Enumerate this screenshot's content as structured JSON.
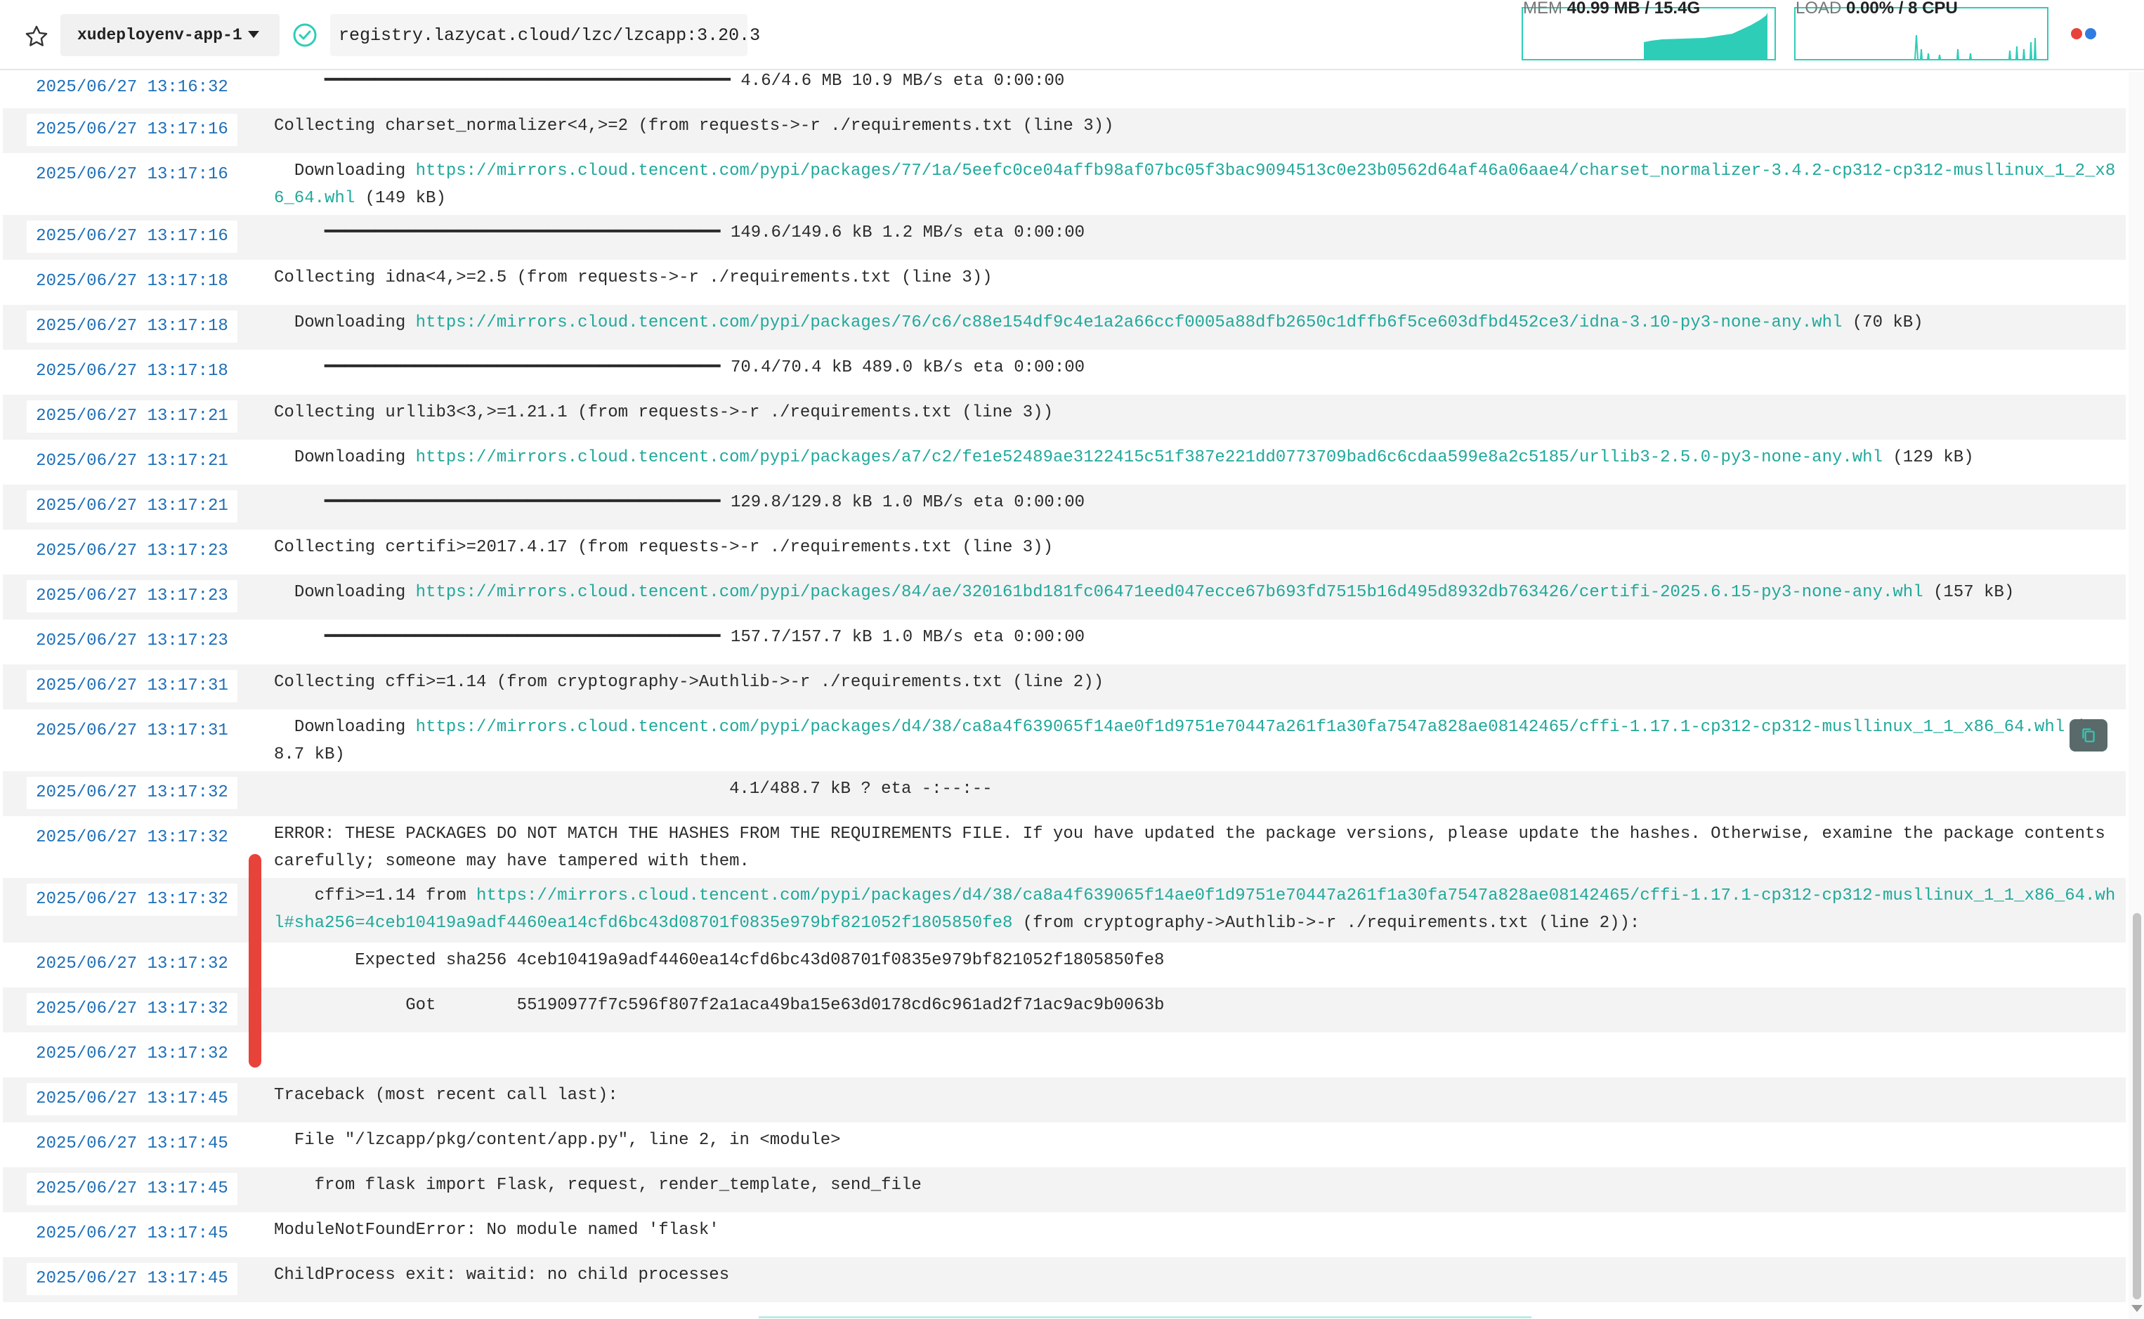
{
  "header": {
    "app_name": "xudeployenv-app-1",
    "image": "registry.lazycat.cloud/lzc/lzcapp:3.20.3",
    "mem": {
      "label": "MEM",
      "value": "40.99 MB / 15.4G"
    },
    "load": {
      "label": "LOAD",
      "value": "0.00% / 8 CPU"
    },
    "accent": "#2ecdb8",
    "status_dots": [
      "#e8433a",
      "#2f7de1"
    ]
  },
  "log": [
    {
      "ts": "2025/06/27 13:16:32",
      "parts": [
        {
          "t": "     ━━━━━━━━━━━━━━━━━━━━━━━━━━━━━━━━━━━━━━━━ 4.6/4.6 MB 10.9 MB/s eta 0:00:00"
        }
      ]
    },
    {
      "ts": "2025/06/27 13:17:16",
      "parts": [
        {
          "t": "Collecting charset_normalizer<4,>=2 (from requests->-r ./requirements.txt (line 3))"
        }
      ]
    },
    {
      "ts": "2025/06/27 13:17:16",
      "parts": [
        {
          "t": "  Downloading "
        },
        {
          "t": "https://mirrors.cloud.tencent.com/pypi/packages/77/1a/5eefc0ce04affb98af07bc05f3bac9094513c0e23b0562d64af46a06aae4/charset_normalizer-3.4.2-cp312-cp312-musllinux_1_2_x86_64.whl",
          "link": true
        },
        {
          "t": " (149 kB)"
        }
      ]
    },
    {
      "ts": "2025/06/27 13:17:16",
      "parts": [
        {
          "t": "     ━━━━━━━━━━━━━━━━━━━━━━━━━━━━━━━━━━━━━━━ 149.6/149.6 kB 1.2 MB/s eta 0:00:00"
        }
      ]
    },
    {
      "ts": "2025/06/27 13:17:18",
      "parts": [
        {
          "t": "Collecting idna<4,>=2.5 (from requests->-r ./requirements.txt (line 3))"
        }
      ]
    },
    {
      "ts": "2025/06/27 13:17:18",
      "parts": [
        {
          "t": "  Downloading "
        },
        {
          "t": "https://mirrors.cloud.tencent.com/pypi/packages/76/c6/c88e154df9c4e1a2a66ccf0005a88dfb2650c1dffb6f5ce603dfbd452ce3/idna-3.10-py3-none-any.whl",
          "link": true
        },
        {
          "t": " (70 kB)"
        }
      ]
    },
    {
      "ts": "2025/06/27 13:17:18",
      "parts": [
        {
          "t": "     ━━━━━━━━━━━━━━━━━━━━━━━━━━━━━━━━━━━━━━━ 70.4/70.4 kB 489.0 kB/s eta 0:00:00"
        }
      ]
    },
    {
      "ts": "2025/06/27 13:17:21",
      "parts": [
        {
          "t": "Collecting urllib3<3,>=1.21.1 (from requests->-r ./requirements.txt (line 3))"
        }
      ]
    },
    {
      "ts": "2025/06/27 13:17:21",
      "parts": [
        {
          "t": "  Downloading "
        },
        {
          "t": "https://mirrors.cloud.tencent.com/pypi/packages/a7/c2/fe1e52489ae3122415c51f387e221dd0773709bad6c6cdaa599e8a2c5185/urllib3-2.5.0-py3-none-any.whl",
          "link": true
        },
        {
          "t": " (129 kB)"
        }
      ]
    },
    {
      "ts": "2025/06/27 13:17:21",
      "parts": [
        {
          "t": "     ━━━━━━━━━━━━━━━━━━━━━━━━━━━━━━━━━━━━━━━ 129.8/129.8 kB 1.0 MB/s eta 0:00:00"
        }
      ]
    },
    {
      "ts": "2025/06/27 13:17:23",
      "parts": [
        {
          "t": "Collecting certifi>=2017.4.17 (from requests->-r ./requirements.txt (line 3))"
        }
      ]
    },
    {
      "ts": "2025/06/27 13:17:23",
      "parts": [
        {
          "t": "  Downloading "
        },
        {
          "t": "https://mirrors.cloud.tencent.com/pypi/packages/84/ae/320161bd181fc06471eed047ecce67b693fd7515b16d495d8932db763426/certifi-2025.6.15-py3-none-any.whl",
          "link": true
        },
        {
          "t": " (157 kB)"
        }
      ]
    },
    {
      "ts": "2025/06/27 13:17:23",
      "parts": [
        {
          "t": "     ━━━━━━━━━━━━━━━━━━━━━━━━━━━━━━━━━━━━━━━ 157.7/157.7 kB 1.0 MB/s eta 0:00:00"
        }
      ]
    },
    {
      "ts": "2025/06/27 13:17:31",
      "parts": [
        {
          "t": "Collecting cffi>=1.14 (from cryptography->Authlib->-r ./requirements.txt (line 2))"
        }
      ]
    },
    {
      "ts": "2025/06/27 13:17:31",
      "parts": [
        {
          "t": "  Downloading "
        },
        {
          "t": "https://mirrors.cloud.tencent.com/pypi/packages/d4/38/ca8a4f639065f14ae0f1d9751e70447a261f1a30fa7547a828ae08142465/cffi-1.17.1-cp312-cp312-musllinux_1_1_x86_64.whl",
          "link": true
        },
        {
          "t": " (488.7 kB)"
        }
      ]
    },
    {
      "ts": "2025/06/27 13:17:32",
      "parts": [
        {
          "t": "                                             4.1/488.7 kB ? eta -:--:--"
        }
      ]
    },
    {
      "ts": "2025/06/27 13:17:32",
      "parts": [
        {
          "t": "ERROR: THESE PACKAGES DO NOT MATCH THE HASHES FROM THE REQUIREMENTS FILE. If you have updated the package versions, please update the hashes. Otherwise, examine the package contents carefully; someone may have tampered with them."
        }
      ]
    },
    {
      "ts": "2025/06/27 13:17:32",
      "parts": [
        {
          "t": "    cffi>=1.14 from "
        },
        {
          "t": "https://mirrors.cloud.tencent.com/pypi/packages/d4/38/ca8a4f639065f14ae0f1d9751e70447a261f1a30fa7547a828ae08142465/cffi-1.17.1-cp312-cp312-musllinux_1_1_x86_64.whl#sha256=4ceb10419a9adf4460ea14cfd6bc43d08701f0835e979bf821052f1805850fe8",
          "link": true
        },
        {
          "t": " (from cryptography->Authlib->-r ./requirements.txt (line 2)):"
        }
      ]
    },
    {
      "ts": "2025/06/27 13:17:32",
      "parts": [
        {
          "t": "        Expected sha256 4ceb10419a9adf4460ea14cfd6bc43d08701f0835e979bf821052f1805850fe8"
        }
      ]
    },
    {
      "ts": "2025/06/27 13:17:32",
      "parts": [
        {
          "t": "             Got        55190977f7c596f807f2a1aca49ba15e63d0178cd6c961ad2f71ac9ac9b0063b"
        }
      ]
    },
    {
      "ts": "2025/06/27 13:17:32",
      "parts": [
        {
          "t": ""
        }
      ]
    },
    {
      "ts": "2025/06/27 13:17:45",
      "parts": [
        {
          "t": "Traceback (most recent call last):"
        }
      ]
    },
    {
      "ts": "2025/06/27 13:17:45",
      "parts": [
        {
          "t": "  File \"/lzcapp/pkg/content/app.py\", line 2, in <module>"
        }
      ]
    },
    {
      "ts": "2025/06/27 13:17:45",
      "parts": [
        {
          "t": "    from flask import Flask, request, render_template, send_file"
        }
      ]
    },
    {
      "ts": "2025/06/27 13:17:45",
      "parts": [
        {
          "t": "ModuleNotFoundError: No module named 'flask'"
        }
      ]
    },
    {
      "ts": "2025/06/27 13:17:45",
      "parts": [
        {
          "t": "ChildProcess exit: waitid: no child processes"
        }
      ]
    }
  ]
}
